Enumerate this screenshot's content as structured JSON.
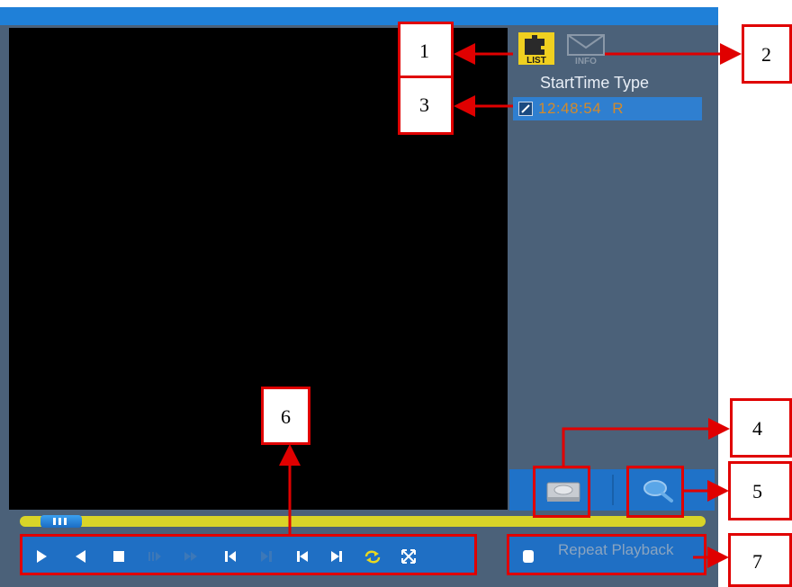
{
  "list": {
    "header": "StartTime Type",
    "items": [
      {
        "checked": true,
        "time": "12:48:54",
        "type": "R"
      }
    ]
  },
  "tabs": {
    "list_icon": "list-icon",
    "info_icon": "info-icon"
  },
  "repeat": {
    "label": "Repeat Playback"
  },
  "controls": [
    {
      "name": "play-icon",
      "enabled": true
    },
    {
      "name": "reverse-play-icon",
      "enabled": true
    },
    {
      "name": "stop-icon",
      "enabled": true
    },
    {
      "name": "slow-play-icon",
      "enabled": false
    },
    {
      "name": "fast-play-icon",
      "enabled": false
    },
    {
      "name": "prev-frame-icon",
      "enabled": true
    },
    {
      "name": "next-frame-icon",
      "enabled": false
    },
    {
      "name": "previous-file-icon",
      "enabled": true
    },
    {
      "name": "next-file-icon",
      "enabled": true
    },
    {
      "name": "repeat-icon",
      "enabled": true
    },
    {
      "name": "fullscreen-icon",
      "enabled": true
    }
  ],
  "playback": {
    "progress": 0.03
  },
  "callouts": [
    "1",
    "2",
    "3",
    "4",
    "5",
    "6",
    "7"
  ],
  "colors": {
    "accent": "#1f80d8",
    "panel": "#4b6179",
    "progress": "#d9d428",
    "callout_border": "#e00000",
    "file_text": "#d48a2a",
    "list_tab": "#f0d020"
  }
}
